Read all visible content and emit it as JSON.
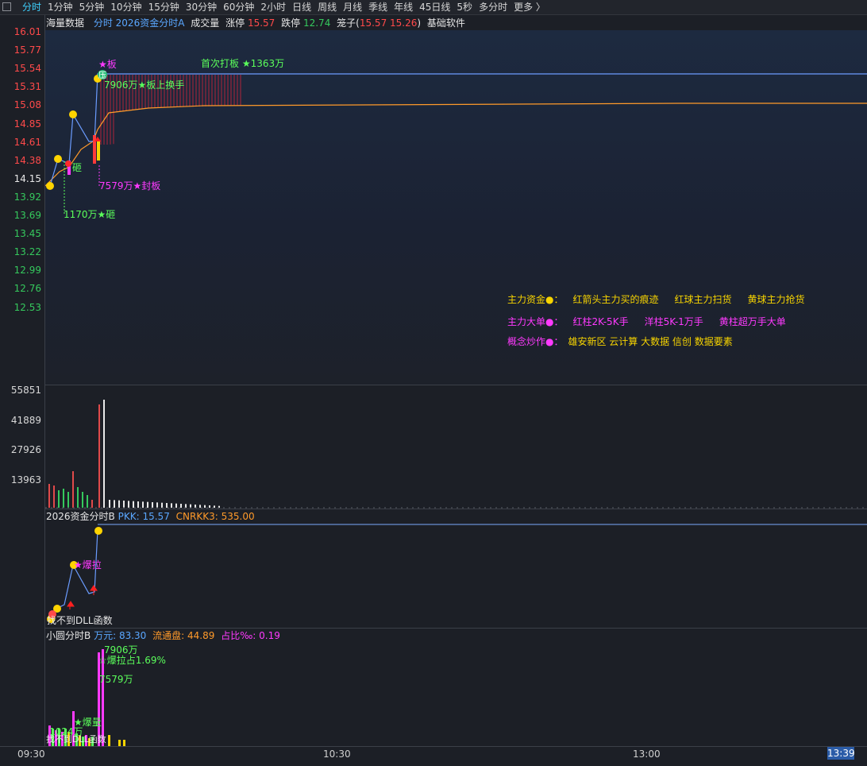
{
  "toolbar": {
    "tabs": [
      "分时",
      "1分钟",
      "5分钟",
      "10分钟",
      "15分钟",
      "30分钟",
      "60分钟",
      "2小时",
      "日线",
      "周线",
      "月线",
      "季线",
      "年线",
      "45日线",
      "5秒",
      "多分时",
      "更多 〉"
    ]
  },
  "main_header": {
    "name": "海量数据",
    "indicator": "分时 2026资金分时A",
    "volume_label": "成交量",
    "limit_up_label": "涨停",
    "limit_up": "15.57",
    "limit_down_label": "跌停",
    "limit_down": "12.74",
    "cage_label": "笼子(",
    "cage_a": "15.57",
    "cage_b": "15.26",
    "cage_close": ")",
    "software": "基础软件"
  },
  "price_axis": [
    {
      "v": "16.01",
      "c": "up"
    },
    {
      "v": "15.77",
      "c": "up"
    },
    {
      "v": "15.54",
      "c": "up"
    },
    {
      "v": "15.31",
      "c": "up"
    },
    {
      "v": "15.08",
      "c": "up"
    },
    {
      "v": "14.85",
      "c": "up"
    },
    {
      "v": "14.61",
      "c": "up"
    },
    {
      "v": "14.38",
      "c": "up"
    },
    {
      "v": "14.15",
      "c": "base"
    },
    {
      "v": "13.92",
      "c": "down"
    },
    {
      "v": "13.69",
      "c": "down"
    },
    {
      "v": "13.45",
      "c": "down"
    },
    {
      "v": "13.22",
      "c": "down"
    },
    {
      "v": "12.99",
      "c": "down"
    },
    {
      "v": "12.76",
      "c": "down"
    },
    {
      "v": "12.53",
      "c": "down"
    }
  ],
  "volume_axis": [
    "55851",
    "41889",
    "27926",
    "13963"
  ],
  "annotations": {
    "board_star": "★板",
    "first_board": "首次打板 ★1363万",
    "board_turnover": "7906万★板上换手",
    "seal": "7579万★封板",
    "smash1": "砸",
    "smash2": "1170万★砸",
    "limit_badge": "压"
  },
  "legend": {
    "row1": [
      "主力资金●：",
      "红箭头主力买的痕迹",
      "红球主力扫货",
      "黄球主力抢货"
    ],
    "row2": [
      "主力大单●：",
      "红柱2K-5K手",
      "洋柱5K-1万手",
      "黄柱超万手大单"
    ],
    "row3_label": "概念炒作●：",
    "row3_items": "雄安新区 云计算 大数据 信创 数据要素"
  },
  "panel_b": {
    "title": "2026资金分时B",
    "pkk_label": "PKK:",
    "pkk": "15.57",
    "cnrkk_label": "CNRKK3:",
    "cnrkk": "535.00",
    "burst": "★爆拉",
    "dll": "找不到DLL函数"
  },
  "panel_c": {
    "title": "小圆分时B",
    "wan_label": "万元:",
    "wan": "83.30",
    "float_label": "流通盘:",
    "float": "44.89",
    "ratio_label": "占比‰:",
    "ratio": "0.19",
    "v1": "7906万",
    "v2": "☆爆拉占1.69%",
    "v3": "7579万",
    "v4": "★爆量",
    "v5": "1024万",
    "v6": "找不到DLL函数"
  },
  "time_axis": [
    "09:30",
    "10:30",
    "13:00",
    "13:39"
  ],
  "colors": {
    "up": "#ff4a4a",
    "down": "#35c95d",
    "gold": "#f7d400",
    "magenta": "#ff3aff",
    "green": "#5bff5b",
    "price_line": "#6b9cff",
    "avg_line": "#ff9a2a"
  }
}
